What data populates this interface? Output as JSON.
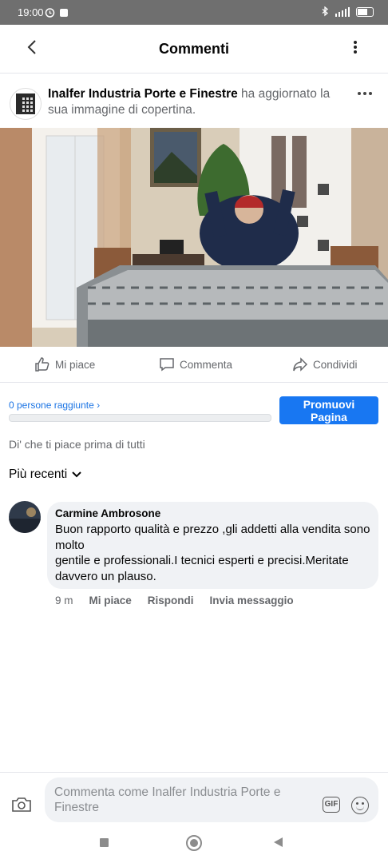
{
  "status_bar": {
    "time": "19:00"
  },
  "header": {
    "title": "Commenti"
  },
  "post": {
    "page_name": "Inalfer Industria Porte e Finestre",
    "action_text": " ha aggiornato la sua immagine di copertina."
  },
  "actions": {
    "like": "Mi piace",
    "comment": "Commenta",
    "share": "Condividi"
  },
  "promo": {
    "reach": "0 persone raggiunte",
    "promote_button": "Promuovi Pagina",
    "reach_progress": 0
  },
  "first_like_prompt": "Di' che ti piace prima di tutti",
  "sort": {
    "label": "Più recenti"
  },
  "comment": {
    "author": "Carmine Ambrosone",
    "text": "Buon rapporto qualità e prezzo ,gli addetti alla vendita sono molto\n gentile e professionali.I tecnici esperti e precisi.Meritate davvero un plauso.",
    "time": "9 m",
    "like": "Mi piace",
    "reply": "Rispondi",
    "message": "Invia messaggio"
  },
  "composer": {
    "placeholder": "Commenta come Inalfer Industria Porte e Finestre",
    "gif_label": "GIF"
  }
}
